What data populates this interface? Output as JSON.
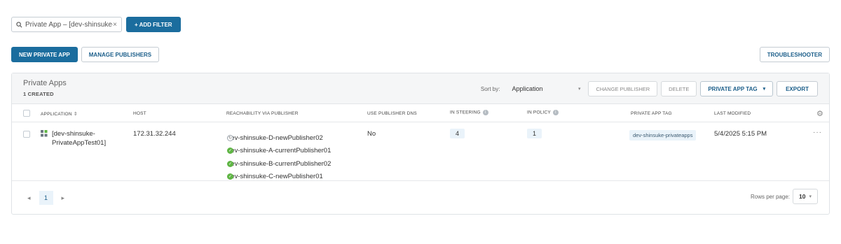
{
  "filter": {
    "chip_text": "Private App – [dev-shinsuke-P...",
    "add_filter": "+ ADD FILTER"
  },
  "actions": {
    "new_private_app": "NEW PRIVATE APP",
    "manage_publishers": "MANAGE PUBLISHERS",
    "troubleshooter": "TROUBLESHOOTER"
  },
  "panel": {
    "title": "Private Apps",
    "subtitle": "1 CREATED",
    "sort_label": "Sort by:",
    "sort_value": "Application",
    "change_publisher": "CHANGE PUBLISHER",
    "delete": "DELETE",
    "private_app_tag": "PRIVATE APP TAG",
    "export": "EXPORT"
  },
  "columns": {
    "application": "APPLICATION",
    "host": "HOST",
    "reachability": "REACHABILITY VIA PUBLISHER",
    "use_publisher_dns": "USE PUBLISHER DNS",
    "in_steering": "IN STEERING",
    "in_policy": "IN POLICY",
    "private_app_tag": "PRIVATE APP TAG",
    "last_modified": "LAST MODIFIED"
  },
  "rows": [
    {
      "name": "[dev-shinsuke-PrivateAppTest01]",
      "host": "172.31.32.244",
      "publishers": [
        {
          "name": "dev-shinsuke-D-newPublisher02",
          "status": "syncing"
        },
        {
          "name": "dev-shinsuke-A-currentPublisher01",
          "status": "ok"
        },
        {
          "name": "dev-shinsuke-B-currentPublisher02",
          "status": "ok"
        },
        {
          "name": "dev-shinsuke-C-newPublisher01",
          "status": "ok"
        }
      ],
      "use_publisher_dns": "No",
      "in_steering": "4",
      "in_policy": "1",
      "tag": "dev-shinsuke-privateapps",
      "last_modified": "5/4/2025 5:15 PM"
    }
  ],
  "pagination": {
    "current_page": "1",
    "rows_per_page_label": "Rows per page:",
    "rows_per_page": "10"
  },
  "colors": {
    "primary": "#1b6d9e",
    "ok_status": "#5fb544",
    "badge_bg": "#eaf3fa"
  }
}
